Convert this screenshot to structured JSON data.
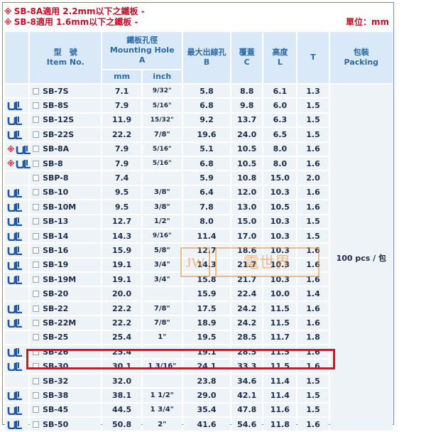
{
  "notes": {
    "line1_mark": "※",
    "line1": "SB-8A適用 2.2mm以下之鐵板 -",
    "line2_mark": "※",
    "line2": "SB-8適用 1.6mm以下之鐵板 -",
    "unit": "單位：mm"
  },
  "headers": {
    "item_zh": "型　號",
    "item_en": "Item No.",
    "hole_zh": "鐵板孔徑",
    "hole_en": "Mounting Hole",
    "hole_letter": "A",
    "mm": "mm",
    "inch": "inch",
    "max_zh": "最大出線孔",
    "max_letter": "B",
    "cover_zh": "覆蓋",
    "cover_letter": "C",
    "height_zh": "高度",
    "height_letter": "L",
    "t": "T",
    "pack_zh": "包裝",
    "pack_en": "Packing"
  },
  "packing": "100 pcs / 包",
  "watermark": {
    "left": "JW",
    "right": "電世界"
  },
  "highlight_row": "SB-30",
  "rows": [
    {
      "cert": "",
      "item": "SB-7S",
      "mm": "7.1",
      "inch": "9/32\"",
      "b": "5.8",
      "c": "8.8",
      "l": "6.1",
      "t": "1.3"
    },
    {
      "cert": "ul",
      "item": "SB-8S",
      "mm": "7.9",
      "inch": "5/16\"",
      "b": "6.8",
      "c": "9.8",
      "l": "6.0",
      "t": "1.5"
    },
    {
      "cert": "ul",
      "item": "SB-12S",
      "mm": "11.9",
      "inch": "15/32\"",
      "b": "9.2",
      "c": "13.7",
      "l": "6.3",
      "t": "1.5"
    },
    {
      "cert": "ul",
      "item": "SB-22S",
      "mm": "22.2",
      "inch": "7/8\"",
      "b": "19.6",
      "c": "24.0",
      "l": "6.5",
      "t": "1.5"
    },
    {
      "cert": "ul-star",
      "item": "SB-8A",
      "mm": "7.9",
      "inch": "5/16\"",
      "b": "5.1",
      "c": "10.5",
      "l": "8.0",
      "t": "1.6"
    },
    {
      "cert": "ul-star",
      "item": "SB-8",
      "mm": "7.9",
      "inch": "5/16\"",
      "b": "6.8",
      "c": "10.5",
      "l": "8.0",
      "t": "1.6"
    },
    {
      "cert": "",
      "item": "SBP-8",
      "mm": "7.4",
      "inch": "",
      "b": "5.9",
      "c": "10.8",
      "l": "15.0",
      "t": "2.0"
    },
    {
      "cert": "ul",
      "item": "SB-10",
      "mm": "9.5",
      "inch": "3/8\"",
      "b": "6.4",
      "c": "12.0",
      "l": "10.3",
      "t": "1.6"
    },
    {
      "cert": "ul",
      "item": "SB-10M",
      "mm": "9.5",
      "inch": "3/8\"",
      "b": "7.8",
      "c": "13.0",
      "l": "10.5",
      "t": "1.6"
    },
    {
      "cert": "ul",
      "item": "SB-13",
      "mm": "12.7",
      "inch": "1/2\"",
      "b": "8.0",
      "c": "15.0",
      "l": "10.3",
      "t": "1.5"
    },
    {
      "cert": "ul",
      "item": "SB-14",
      "mm": "14.3",
      "inch": "9/16\"",
      "b": "11.4",
      "c": "17.0",
      "l": "10.3",
      "t": "1.5"
    },
    {
      "cert": "ul",
      "item": "SB-16",
      "mm": "15.9",
      "inch": "5/8\"",
      "b": "12.7",
      "c": "18.6",
      "l": "10.3",
      "t": "1.6"
    },
    {
      "cert": "ul",
      "item": "SB-19",
      "mm": "19.1",
      "inch": "3/4\"",
      "b": "14.3",
      "c": "21.7",
      "l": "10.3",
      "t": "1.6"
    },
    {
      "cert": "ul",
      "item": "SB-19M",
      "mm": "19.1",
      "inch": "3/4\"",
      "b": "15.8",
      "c": "21.7",
      "l": "10.3",
      "t": "1.6"
    },
    {
      "cert": "",
      "item": "SB-20",
      "mm": "20.0",
      "inch": "",
      "b": "15.9",
      "c": "22.4",
      "l": "10.0",
      "t": "1.4"
    },
    {
      "cert": "ul",
      "item": "SB-22",
      "mm": "22.2",
      "inch": "7/8\"",
      "b": "17.5",
      "c": "24.2",
      "l": "11.5",
      "t": "1.6"
    },
    {
      "cert": "ul",
      "item": "SB-22M",
      "mm": "22.2",
      "inch": "7/8\"",
      "b": "18.9",
      "c": "24.2",
      "l": "11.5",
      "t": "1.6"
    },
    {
      "cert": "",
      "item": "SB-25",
      "mm": "25.4",
      "inch": "1\"",
      "b": "19.5",
      "c": "28.5",
      "l": "11.7",
      "t": "1.8"
    },
    {
      "cert": "ul",
      "item": "SB-26",
      "mm": "25.4",
      "inch": "",
      "b": "19.1",
      "c": "28.5",
      "l": "11.5",
      "t": "1.6"
    },
    {
      "cert": "ul",
      "item": "SB-30",
      "mm": "30.1",
      "inch": "1 3/16\"",
      "b": "24.1",
      "c": "33.3",
      "l": "11.5",
      "t": "1.6"
    },
    {
      "cert": "",
      "item": "SB-32",
      "mm": "32.0",
      "inch": "",
      "b": "23.8",
      "c": "34.6",
      "l": "11.4",
      "t": "1.5"
    },
    {
      "cert": "ul",
      "item": "SB-38",
      "mm": "38.1",
      "inch": "1 1/2\"",
      "b": "29.0",
      "c": "42.1",
      "l": "11.4",
      "t": "1.5"
    },
    {
      "cert": "ul",
      "item": "SB-45",
      "mm": "44.5",
      "inch": "1 3/4\"",
      "b": "35.4",
      "c": "47.8",
      "l": "11.6",
      "t": "1.5"
    },
    {
      "cert": "ul",
      "item": "SB-50",
      "mm": "50.8",
      "inch": "2\"",
      "b": "41.6",
      "c": "54.6",
      "l": "11.8",
      "t": "1.6"
    }
  ],
  "colors": {
    "header_bg": "#d9e9f7",
    "header_text": "#2b6aa8",
    "cell_bg": "#eef3f8",
    "note_red": "#c0102a",
    "highlight": "#e01020",
    "ul_blue": "#1f56a8"
  }
}
